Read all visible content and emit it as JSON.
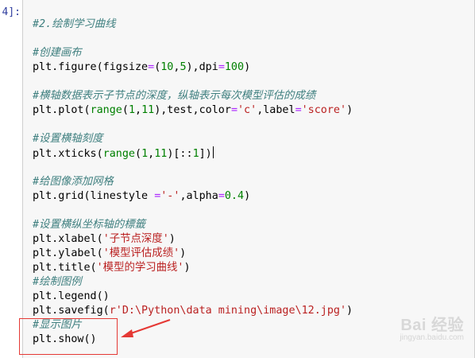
{
  "prompt": "4]:",
  "code_lines": [
    [
      {
        "t": "#2.绘制学习曲线",
        "c": "cm"
      }
    ],
    [],
    [
      {
        "t": "#创建画布",
        "c": "cm"
      }
    ],
    [
      {
        "t": "plt.figure(figsize",
        "c": ""
      },
      {
        "t": "=",
        "c": "op"
      },
      {
        "t": "(",
        "c": ""
      },
      {
        "t": "10",
        "c": "num"
      },
      {
        "t": ",",
        "c": ""
      },
      {
        "t": "5",
        "c": "num"
      },
      {
        "t": "),dpi",
        "c": ""
      },
      {
        "t": "=",
        "c": "op"
      },
      {
        "t": "100",
        "c": "num"
      },
      {
        "t": ")",
        "c": ""
      }
    ],
    [],
    [
      {
        "t": "#横轴数据表示子节点的深度，纵轴表示每次模型评估的成绩",
        "c": "cm"
      }
    ],
    [
      {
        "t": "plt.plot(",
        "c": ""
      },
      {
        "t": "range",
        "c": "kw"
      },
      {
        "t": "(",
        "c": ""
      },
      {
        "t": "1",
        "c": "num"
      },
      {
        "t": ",",
        "c": ""
      },
      {
        "t": "11",
        "c": "num"
      },
      {
        "t": "),test,color",
        "c": ""
      },
      {
        "t": "=",
        "c": "op"
      },
      {
        "t": "'c'",
        "c": "str"
      },
      {
        "t": ",label",
        "c": ""
      },
      {
        "t": "=",
        "c": "op"
      },
      {
        "t": "'score'",
        "c": "str"
      },
      {
        "t": ")",
        "c": ""
      }
    ],
    [],
    [
      {
        "t": "#设置横轴刻度",
        "c": "cm"
      }
    ],
    [
      {
        "t": "plt.xticks(",
        "c": ""
      },
      {
        "t": "range",
        "c": "kw"
      },
      {
        "t": "(",
        "c": ""
      },
      {
        "t": "1",
        "c": "num"
      },
      {
        "t": ",",
        "c": ""
      },
      {
        "t": "11",
        "c": "num"
      },
      {
        "t": ")[::",
        "c": ""
      },
      {
        "t": "1",
        "c": "num"
      },
      {
        "t": "])",
        "c": ""
      },
      {
        "t": "",
        "c": "cursor"
      }
    ],
    [],
    [
      {
        "t": "#给图像添加网格",
        "c": "cm"
      }
    ],
    [
      {
        "t": "plt.grid(linestyle ",
        "c": ""
      },
      {
        "t": "=",
        "c": "op"
      },
      {
        "t": "'-'",
        "c": "str"
      },
      {
        "t": ",alpha",
        "c": ""
      },
      {
        "t": "=",
        "c": "op"
      },
      {
        "t": "0.4",
        "c": "num"
      },
      {
        "t": ")",
        "c": ""
      }
    ],
    [],
    [
      {
        "t": "#设置横纵坐标轴的標籤",
        "c": "cm"
      }
    ],
    [
      {
        "t": "plt.xlabel(",
        "c": ""
      },
      {
        "t": "'子节点深度'",
        "c": "str"
      },
      {
        "t": ")",
        "c": ""
      }
    ],
    [
      {
        "t": "plt.ylabel(",
        "c": ""
      },
      {
        "t": "'模型评估成绩'",
        "c": "str"
      },
      {
        "t": ")",
        "c": ""
      }
    ],
    [
      {
        "t": "plt.title(",
        "c": ""
      },
      {
        "t": "'模型的学习曲线'",
        "c": "str"
      },
      {
        "t": ")",
        "c": ""
      }
    ],
    [
      {
        "t": "#绘制图例",
        "c": "cm"
      }
    ],
    [
      {
        "t": "plt.legend()",
        "c": ""
      }
    ],
    [
      {
        "t": "plt.savefig(",
        "c": ""
      },
      {
        "t": "r'D:\\Python\\data mining\\image\\12.jpg'",
        "c": "str"
      },
      {
        "t": ")",
        "c": ""
      }
    ],
    [
      {
        "t": "#显示图片",
        "c": "cm"
      }
    ],
    [
      {
        "t": "plt.show()",
        "c": ""
      }
    ]
  ],
  "watermark": {
    "main": "Bai 经验",
    "sub": "jingyan.baidu.com"
  },
  "colors": {
    "highlight": "#e53935",
    "cell_bg": "#f7f7f7"
  },
  "icons": {
    "arrow": "red-arrow-icon"
  }
}
